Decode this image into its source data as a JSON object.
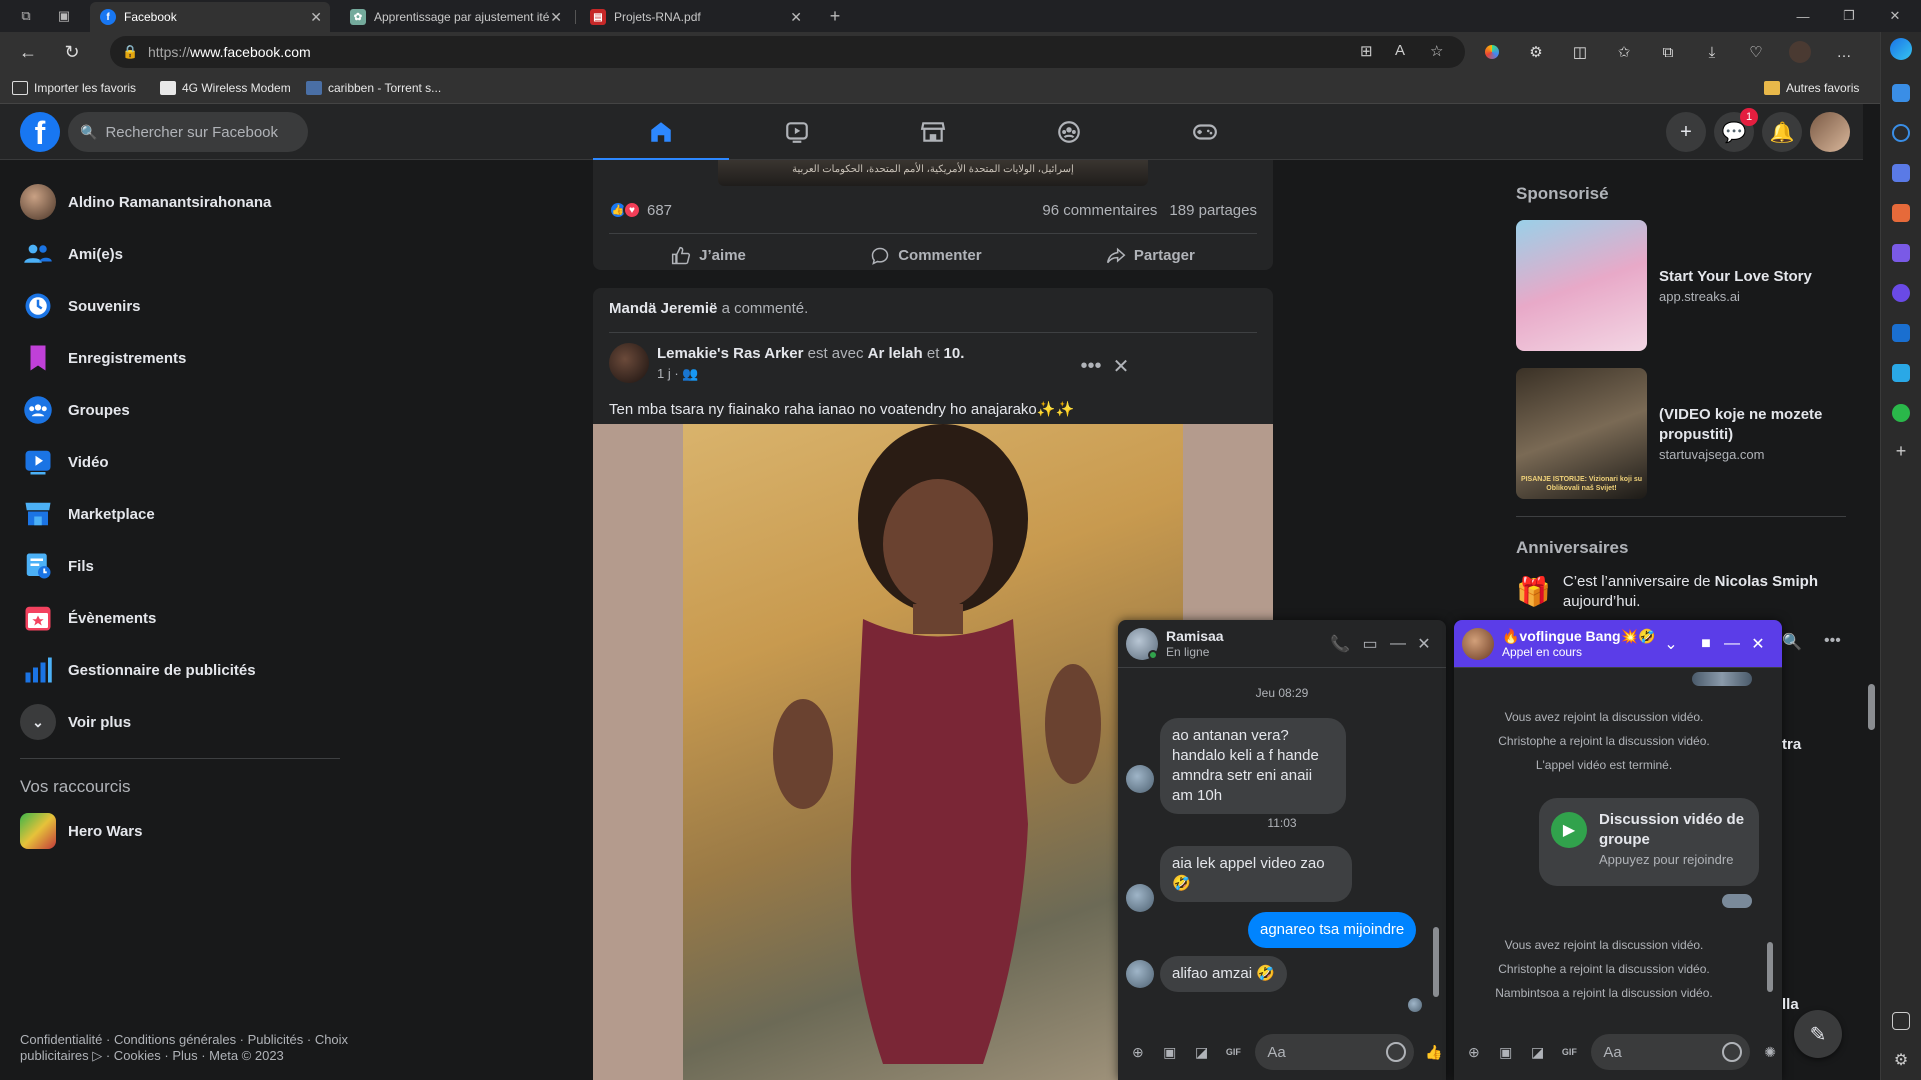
{
  "browser": {
    "tabs": [
      {
        "title": "Facebook",
        "icon": "facebook-favicon",
        "active": true
      },
      {
        "title": "Apprentissage par ajustement ité",
        "icon": "chatgpt-favicon",
        "active": false
      },
      {
        "title": "Projets-RNA.pdf",
        "icon": "pdf-favicon",
        "active": false
      }
    ],
    "url_protocol": "https://",
    "url_host": "www.facebook.com",
    "bookmarks": [
      "Importer les favoris",
      "4G Wireless Modem",
      "caribben - Torrent s...",
      "Autres favoris"
    ]
  },
  "facebook": {
    "search_placeholder": "Rechercher sur Facebook",
    "messenger_badge": "1",
    "nav": [
      "Accueil",
      "Vidéo",
      "Marketplace",
      "Groupes",
      "Jeux"
    ]
  },
  "sidebar": {
    "items": [
      {
        "label": "Aldino Ramanantsirahonana",
        "icon": "profile-avatar"
      },
      {
        "label": "Ami(e)s",
        "icon": "friends-icon"
      },
      {
        "label": "Souvenirs",
        "icon": "clock-icon"
      },
      {
        "label": "Enregistrements",
        "icon": "bookmark-icon"
      },
      {
        "label": "Groupes",
        "icon": "groups-icon"
      },
      {
        "label": "Vidéo",
        "icon": "video-icon"
      },
      {
        "label": "Marketplace",
        "icon": "shop-icon"
      },
      {
        "label": "Fils",
        "icon": "feeds-icon"
      },
      {
        "label": "Évènements",
        "icon": "calendar-icon"
      },
      {
        "label": "Gestionnaire de publicités",
        "icon": "bar-chart-icon"
      },
      {
        "label": "Voir plus",
        "icon": "chevron-down-icon"
      }
    ],
    "shortcuts_title": "Vos raccourcis",
    "shortcuts": [
      {
        "label": "Hero Wars"
      }
    ],
    "footer": "Confidentialité · Conditions générales · Publicités · Choix publicitaires ▷ · Cookies · Plus · Meta © 2023"
  },
  "post1": {
    "image_caption": "إسرائيل، الولايات المتحدة الأمريكية، الأمم المتحدة، الحكومات العربية",
    "reactions": "687",
    "comments": "96 commentaires",
    "shares": "189 partages",
    "like_label": "J’aime",
    "comment_label": "Commenter",
    "share_label": "Partager"
  },
  "post2": {
    "commenter": "Mandä Jeremië",
    "commented": "a commenté.",
    "author": "Lemakie's Ras Arker",
    "with_text": "est avec",
    "with_name": "Ar lelah",
    "and_text": "et",
    "others": "10.",
    "time": "1 j ·",
    "text": "Ten mba tsara ny fiainako raha ianao no voatendry ho anajarako✨✨"
  },
  "right": {
    "sponsored_title": "Sponsorisé",
    "ads": [
      {
        "title": "Start Your Love Story",
        "site": "app.streaks.ai"
      },
      {
        "title": "(VIDEO koje ne mozete propustiti)",
        "site": "startuvajsega.com",
        "image_caption": "PISANJE ISTORIJE: Vizionari koji su Oblikovali naš Svijet!"
      }
    ],
    "birthdays_title": "Anniversaires",
    "birthday_prefix": "C’est l’anniversaire de",
    "birthday_name": "Nicolas Smiph",
    "birthday_suffix": "aujourd’hui."
  },
  "chat1": {
    "name": "Ramisaa",
    "status": "En ligne",
    "messages": [
      {
        "type": "time",
        "text": "Jeu 08:29"
      },
      {
        "type": "in",
        "text": "ao antanan vera?handalo keli a f hande amndra setr eni anaii am 10h"
      },
      {
        "type": "time",
        "text": "11:03"
      },
      {
        "type": "in",
        "text": "aia lek appel video zao 🤣"
      },
      {
        "type": "out",
        "text": "agnareo tsa mijoindre"
      },
      {
        "type": "in",
        "text": "alifao amzai 🤣"
      }
    ],
    "input_placeholder": "Aa"
  },
  "chat2": {
    "name": "🔥voflingue Bang💥🤣",
    "status": "Appel en cours",
    "system": [
      "Vous avez rejoint la discussion vidéo.",
      "Christophe a rejoint la discussion vidéo.",
      "L'appel vidéo est terminé.",
      "Vous avez rejoint la discussion vidéo.",
      "Christophe a rejoint la discussion vidéo.",
      "Nambintsoa a rejoint la discussion vidéo."
    ],
    "call_title": "Discussion vidéo de groupe",
    "call_sub": "Appuyez pour rejoindre",
    "input_placeholder": "Aa",
    "clipped_right_1": "tra",
    "clipped_right_2": "lla"
  },
  "colors": {
    "accent": "#1877f2",
    "bg": "#18191a",
    "card": "#242526",
    "live_chat": "#5b3de8"
  }
}
